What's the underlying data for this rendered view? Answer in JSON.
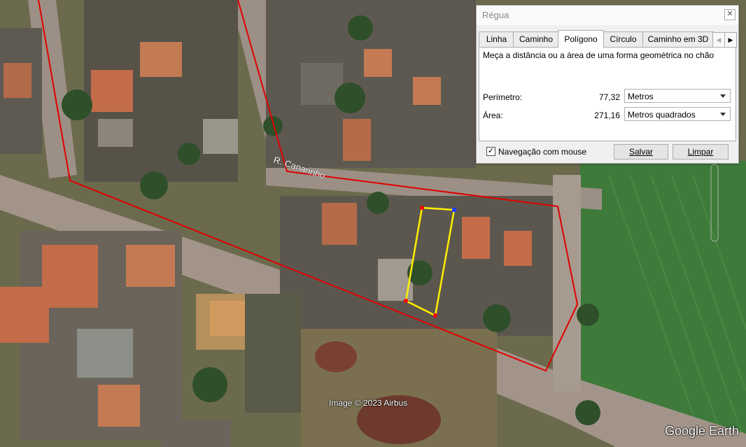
{
  "dialog": {
    "title": "Régua",
    "close_icon": "close-icon",
    "tabs": [
      {
        "label": "Linha",
        "active": false
      },
      {
        "label": "Caminho",
        "active": false
      },
      {
        "label": "Polígono",
        "active": true
      },
      {
        "label": "Círculo",
        "active": false
      },
      {
        "label": "Caminho em 3D",
        "active": false
      }
    ],
    "description": "Meça a distância ou a área de uma forma geométrica no chão",
    "perimeter": {
      "label": "Perímetro:",
      "value": "77,32",
      "unit": "Metros"
    },
    "area": {
      "label": "Área:",
      "value": "271,16",
      "unit": "Metros quadrados"
    },
    "mouse_navigation": {
      "label": "Navegação com mouse",
      "checked": true
    },
    "save_label": "Salvar",
    "clear_label": "Limpar"
  },
  "map": {
    "street_label": "R. Canarinho",
    "imagery_credit": "Image © 2023 Airbus",
    "brand": "Google Earth",
    "colors": {
      "boundary": "#e00000",
      "measurement": "#ffee00"
    }
  }
}
